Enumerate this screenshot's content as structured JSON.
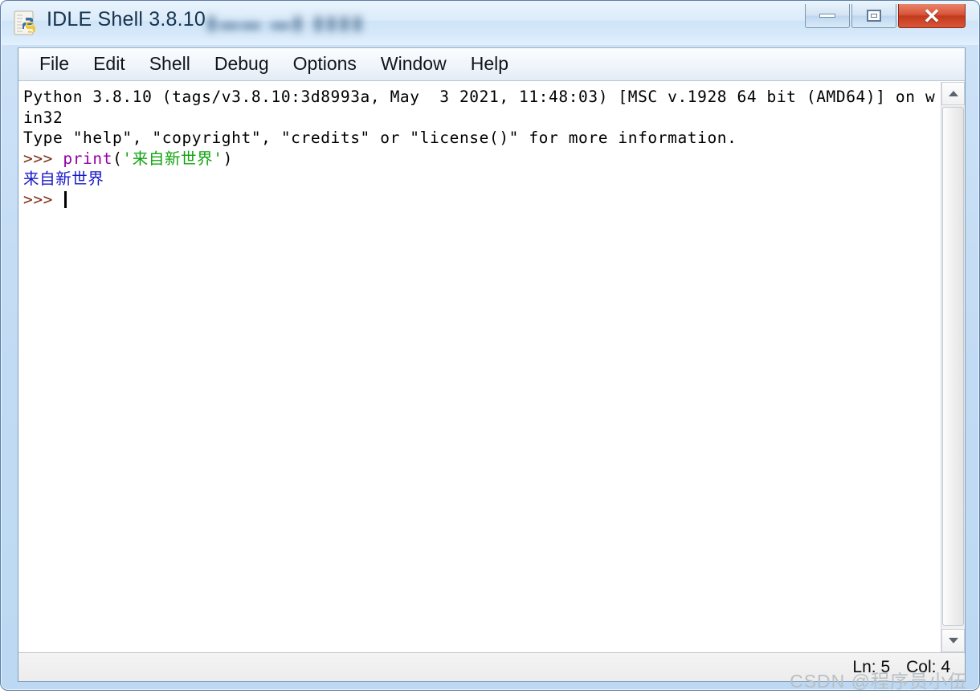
{
  "window": {
    "title": "IDLE Shell 3.8.10",
    "blurred_title_suffix": "▮▬▬ ▬▮ ▮▮▮▮",
    "icon": "python-idle-icon",
    "controls": {
      "minimize": "minimize-icon",
      "maximize": "restore-icon",
      "close": "✕"
    },
    "colors": {
      "frame": "#bcd8f2",
      "close_button": "#c23a1c",
      "client": "#ffffff"
    }
  },
  "menu": {
    "items": [
      {
        "label": "File"
      },
      {
        "label": "Edit"
      },
      {
        "label": "Shell"
      },
      {
        "label": "Debug"
      },
      {
        "label": "Options"
      },
      {
        "label": "Window"
      },
      {
        "label": "Help"
      }
    ]
  },
  "shell": {
    "lines": [
      {
        "type": "banner",
        "segments": [
          {
            "text": "Python 3.8.10 (tags/v3.8.10:3d8993a, May  3 2021, 11:48:03) [MSC v.1928 64 bit (AMD64)] on win32",
            "style": "plain"
          }
        ]
      },
      {
        "type": "banner",
        "segments": [
          {
            "text": "Type \"help\", \"copyright\", \"credits\" or \"license()\" for more information.",
            "style": "plain"
          }
        ]
      },
      {
        "type": "input",
        "segments": [
          {
            "text": ">>> ",
            "style": "prompt"
          },
          {
            "text": "print",
            "style": "keyword"
          },
          {
            "text": "(",
            "style": "plain"
          },
          {
            "text": "'来自新世界'",
            "style": "string"
          },
          {
            "text": ")",
            "style": "plain"
          }
        ]
      },
      {
        "type": "output",
        "segments": [
          {
            "text": "来自新世界",
            "style": "output"
          }
        ]
      },
      {
        "type": "input",
        "segments": [
          {
            "text": ">>> ",
            "style": "prompt"
          }
        ],
        "caret": true
      }
    ],
    "syntax_colors": {
      "prompt": "#7d2e14",
      "keyword": "#9400a8",
      "string": "#0fa30f",
      "output": "#1818c8",
      "plain": "#000000"
    }
  },
  "scrollbar": {
    "up_arrow": "chevron-up-icon",
    "down_arrow": "chevron-down-icon"
  },
  "status": {
    "line": "Ln: 5",
    "column": "Col: 4"
  },
  "watermark": {
    "text": "CSDN @程序员小伍"
  }
}
